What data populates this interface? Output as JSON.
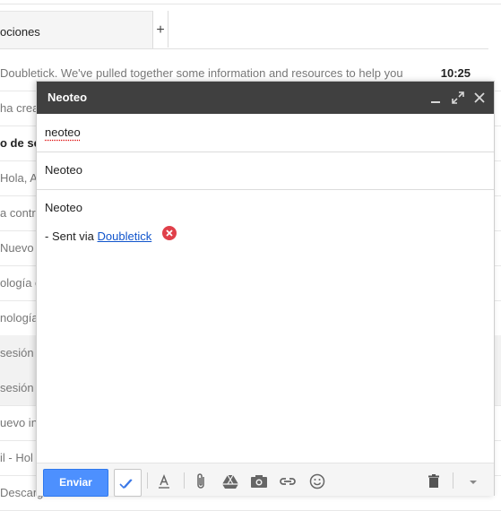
{
  "inbox": {
    "tab_label": "ociones",
    "tab_add_label": "+",
    "rows": [
      {
        "text": "Doubletick. We've pulled together some information and resources to help you",
        "time": "10:25",
        "bold": false,
        "shaded": false
      },
      {
        "text": "ha crea",
        "time": "",
        "bold": false,
        "shaded": false
      },
      {
        "text": "o de se",
        "time": "",
        "bold": true,
        "shaded": false
      },
      {
        "text": "Hola, A",
        "time": "",
        "bold": false,
        "shaded": false
      },
      {
        "text": "a contra",
        "time": "",
        "bold": false,
        "shaded": false
      },
      {
        "text": "Nuevo in",
        "time": "",
        "bold": false,
        "shaded": false
      },
      {
        "text": "ología c",
        "time": "",
        "bold": false,
        "shaded": false
      },
      {
        "text": "nología",
        "time": "",
        "bold": false,
        "shaded": false
      },
      {
        "text": "sesión c",
        "time": "",
        "bold": false,
        "shaded": true
      },
      {
        "text": "sesión c",
        "time": "",
        "bold": false,
        "shaded": true
      },
      {
        "text": "uevo in",
        "time": "",
        "bold": false,
        "shaded": false
      },
      {
        "text": "il - Hol",
        "time": "",
        "bold": false,
        "shaded": false
      },
      {
        "text": "Descarg",
        "time": "",
        "bold": false,
        "shaded": false
      }
    ]
  },
  "compose": {
    "title": "Neoteo",
    "to_value": "neoteo",
    "subject_value": "Neoteo",
    "body_line": "Neoteo",
    "signature_prefix": "- Sent via ",
    "signature_link": "Doubletick",
    "send_label": "Enviar"
  },
  "colors": {
    "header_bg": "#404040",
    "send_button": "#4d90fe",
    "link": "#1155cc",
    "remove_badge": "#e0404a"
  },
  "icons": {
    "toolbar": [
      "double-check-icon",
      "text-format-icon",
      "paperclip-icon",
      "drive-icon",
      "camera-icon",
      "link-icon",
      "smiley-icon",
      "trash-icon",
      "dropdown-arrow-icon"
    ],
    "header": [
      "minimize-icon",
      "expand-icon",
      "close-icon"
    ]
  }
}
